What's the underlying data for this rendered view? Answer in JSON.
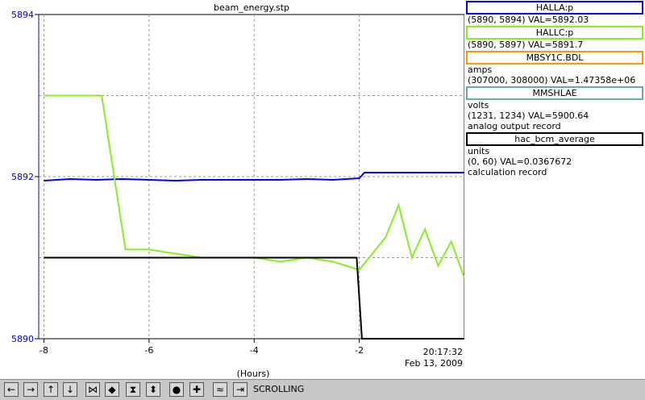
{
  "chart_data": {
    "type": "line",
    "title": "beam_energy.stp",
    "xlabel": "(Hours)",
    "timestamp_time": "20:17:32",
    "timestamp_date": "Feb 13, 2009",
    "xlim": [
      -8.1,
      0
    ],
    "ylim": [
      5890,
      5894
    ],
    "x_ticks": [
      -8,
      -6,
      -4,
      -2
    ],
    "x_tick_labels": [
      "-8",
      "-6",
      "-4",
      "-2"
    ],
    "y_ticks": [
      5890,
      5892,
      5894
    ],
    "y_tick_labels": [
      "5890",
      "5892",
      "5894"
    ],
    "y_axis_color": "#0000cc",
    "grid": true,
    "series": [
      {
        "name": "HALLA:p",
        "color": "#0000ff",
        "x": [
          -8.0,
          -7.5,
          -7.0,
          -6.5,
          -6.0,
          -5.5,
          -5.0,
          -4.5,
          -4.0,
          -3.5,
          -3.0,
          -2.5,
          -2.0,
          -1.9,
          -1.0,
          0.0
        ],
        "y": [
          5891.95,
          5891.97,
          5891.96,
          5891.97,
          5891.96,
          5891.95,
          5891.96,
          5891.96,
          5891.96,
          5891.96,
          5891.97,
          5891.96,
          5891.98,
          5892.05,
          5892.05,
          5892.05
        ]
      },
      {
        "name": "HALLC:p",
        "color": "#88ee22",
        "x": [
          -8.0,
          -6.9,
          -6.45,
          -6.0,
          -5.5,
          -5.0,
          -4.5,
          -4.0,
          -3.5,
          -3.0,
          -2.5,
          -2.0,
          -1.75,
          -1.5,
          -1.25,
          -1.0,
          -0.75,
          -0.5,
          -0.25,
          0.0
        ],
        "y": [
          5893.0,
          5893.0,
          5891.1,
          5891.1,
          5891.05,
          5891.0,
          5891.0,
          5891.0,
          5890.95,
          5891.0,
          5890.95,
          5890.85,
          5891.05,
          5891.25,
          5891.65,
          5891.0,
          5891.35,
          5890.9,
          5891.2,
          5890.75
        ]
      },
      {
        "name": "hac_bcm_average",
        "color": "#000000",
        "x": [
          -8.0,
          -7.0,
          -6.0,
          -5.0,
          -4.0,
          -3.0,
          -2.05,
          -1.95,
          0.0
        ],
        "y": [
          5891.0,
          5891.0,
          5891.0,
          5891.0,
          5891.0,
          5891.0,
          5891.0,
          5890.0,
          5890.0
        ]
      }
    ]
  },
  "legend": [
    {
      "name": "HALLA:p",
      "color": "#0000ff",
      "lines": [
        "(5890, 5894) VAL=5892.03"
      ]
    },
    {
      "name": "HALLC:p",
      "color": "#88ee22",
      "lines": [
        "(5890, 5897) VAL=5891.7"
      ]
    },
    {
      "name": "MBSY1C.BDL",
      "color": "#ff9900",
      "lines": [
        "amps",
        "(307000, 308000) VAL=1.47358e+06"
      ]
    },
    {
      "name": "MMSHLAE",
      "color": "#66aaaa",
      "lines": [
        "volts",
        "(1231, 1234) VAL=5900.64",
        "analog output record"
      ]
    },
    {
      "name": "hac_bcm_average",
      "color": "#000000",
      "lines": [
        "units",
        "(0, 60) VAL=0.0367672",
        "calculation record"
      ]
    }
  ],
  "toolbar": {
    "buttons": [
      {
        "icon": "arrow-left-icon",
        "glyph": "←"
      },
      {
        "icon": "arrow-right-icon",
        "glyph": "→"
      },
      {
        "icon": "arrow-up-icon",
        "glyph": "↑"
      },
      {
        "icon": "arrow-down-icon",
        "glyph": "↓"
      },
      {
        "icon": "compress-horizontal-icon",
        "glyph": "⋈"
      },
      {
        "icon": "expand-horizontal-icon",
        "glyph": "◆"
      },
      {
        "icon": "compress-vertical-icon",
        "glyph": "⧗"
      },
      {
        "icon": "expand-vertical-icon",
        "glyph": "⬍"
      },
      {
        "icon": "ring-icon",
        "glyph": "●"
      },
      {
        "icon": "plus-icon",
        "glyph": "✚"
      },
      {
        "icon": "autoscale-icon",
        "glyph": "≈"
      },
      {
        "icon": "scroll-end-icon",
        "glyph": "⇥"
      }
    ],
    "mode_label": "SCROLLING"
  }
}
